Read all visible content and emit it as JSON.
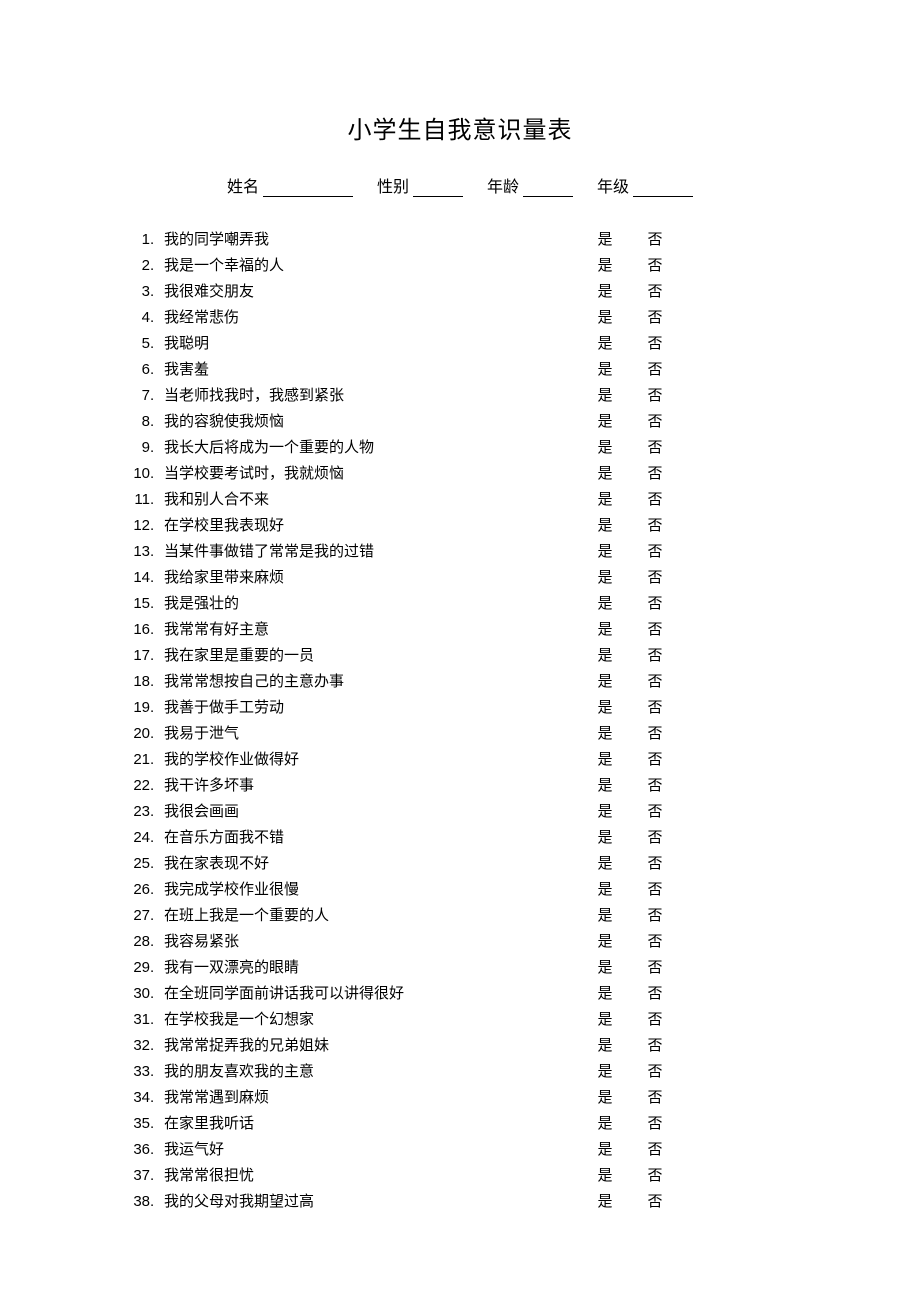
{
  "title": "小学生自我意识量表",
  "fields": {
    "name_label": "姓名",
    "gender_label": "性别",
    "age_label": "年龄",
    "grade_label": "年级"
  },
  "yes_label": "是",
  "no_label": "否",
  "items": [
    {
      "num": "1",
      "text": "我的同学嘲弄我"
    },
    {
      "num": "2",
      "text": "我是一个幸福的人"
    },
    {
      "num": "3",
      "text": "我很难交朋友"
    },
    {
      "num": "4",
      "text": "我经常悲伤"
    },
    {
      "num": "5",
      "text": "我聪明"
    },
    {
      "num": "6",
      "text": "我害羞"
    },
    {
      "num": "7",
      "text": "当老师找我时，我感到紧张"
    },
    {
      "num": "8",
      "text": "我的容貌使我烦恼"
    },
    {
      "num": "9",
      "text": "我长大后将成为一个重要的人物"
    },
    {
      "num": "10",
      "text": "当学校要考试时，我就烦恼"
    },
    {
      "num": "11",
      "text": "我和别人合不来"
    },
    {
      "num": "12",
      "text": "在学校里我表现好"
    },
    {
      "num": "13",
      "text": "当某件事做错了常常是我的过错"
    },
    {
      "num": "14",
      "text": "我给家里带来麻烦"
    },
    {
      "num": "15",
      "text": "我是强壮的"
    },
    {
      "num": "16",
      "text": "我常常有好主意"
    },
    {
      "num": "17",
      "text": "我在家里是重要的一员"
    },
    {
      "num": "18",
      "text": "我常常想按自己的主意办事"
    },
    {
      "num": "19",
      "text": "我善于做手工劳动"
    },
    {
      "num": "20",
      "text": "我易于泄气"
    },
    {
      "num": "21",
      "text": "我的学校作业做得好"
    },
    {
      "num": "22",
      "text": "我干许多坏事"
    },
    {
      "num": "23",
      "text": "我很会画画"
    },
    {
      "num": "24",
      "text": "在音乐方面我不错"
    },
    {
      "num": "25",
      "text": "我在家表现不好"
    },
    {
      "num": "26",
      "text": "我完成学校作业很慢"
    },
    {
      "num": "27",
      "text": "在班上我是一个重要的人"
    },
    {
      "num": "28",
      "text": "我容易紧张"
    },
    {
      "num": "29",
      "text": "我有一双漂亮的眼睛"
    },
    {
      "num": "30",
      "text": "在全班同学面前讲话我可以讲得很好"
    },
    {
      "num": "31",
      "text": "在学校我是一个幻想家"
    },
    {
      "num": "32",
      "text": "我常常捉弄我的兄弟姐妹"
    },
    {
      "num": "33",
      "text": "我的朋友喜欢我的主意"
    },
    {
      "num": "34",
      "text": "我常常遇到麻烦"
    },
    {
      "num": "35",
      "text": "在家里我听话"
    },
    {
      "num": "36",
      "text": "我运气好"
    },
    {
      "num": "37",
      "text": "我常常很担忧"
    },
    {
      "num": "38",
      "text": "我的父母对我期望过高"
    }
  ]
}
